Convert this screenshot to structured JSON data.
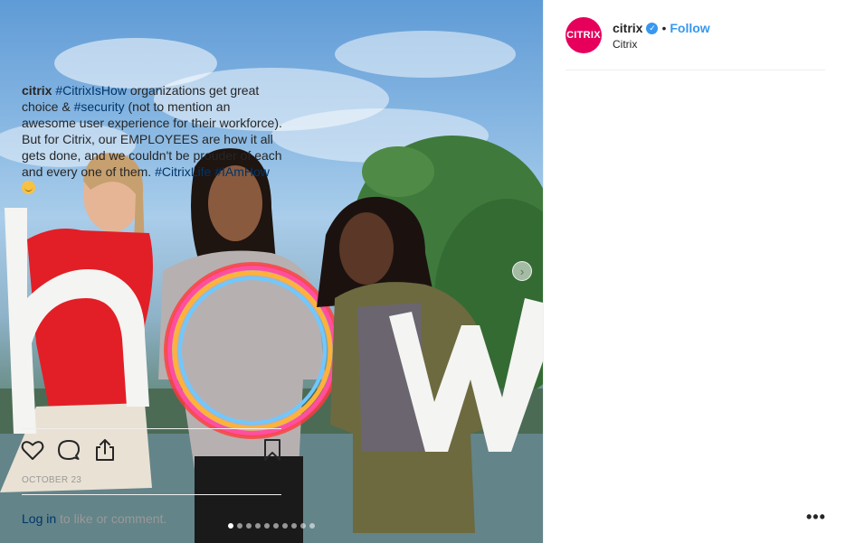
{
  "post": {
    "account": {
      "username": "citrix",
      "avatar_text": "CITRIX",
      "verified": true,
      "follow_label": "Follow",
      "separator": "•",
      "location": "Citrix"
    },
    "caption": {
      "author": "citrix",
      "tag1": "#CitrixIsHow",
      "text1": " organizations get great choice & ",
      "tag2": "#security",
      "text2": " (not to mention an awesome user experience for their workforce). But for Citrix, our EMPLOYEES are how it all gets done, and we couldn't be prouder of each and every one of them. ",
      "tag3": "#CitrixLife",
      "tag4": "#IAmHow"
    },
    "date": "OCTOBER 23",
    "login": {
      "link": "Log in",
      "rest": " to like or comment."
    },
    "more_label": "•••",
    "carousel": {
      "current": 1,
      "total": 10,
      "next_glyph": "›"
    },
    "icons": [
      "heart-icon",
      "comment-icon",
      "share-icon",
      "bookmark-icon"
    ],
    "colors": {
      "link": "#003569",
      "follow": "#3897f0",
      "brand": "#e6005c",
      "muted": "#999999"
    }
  }
}
